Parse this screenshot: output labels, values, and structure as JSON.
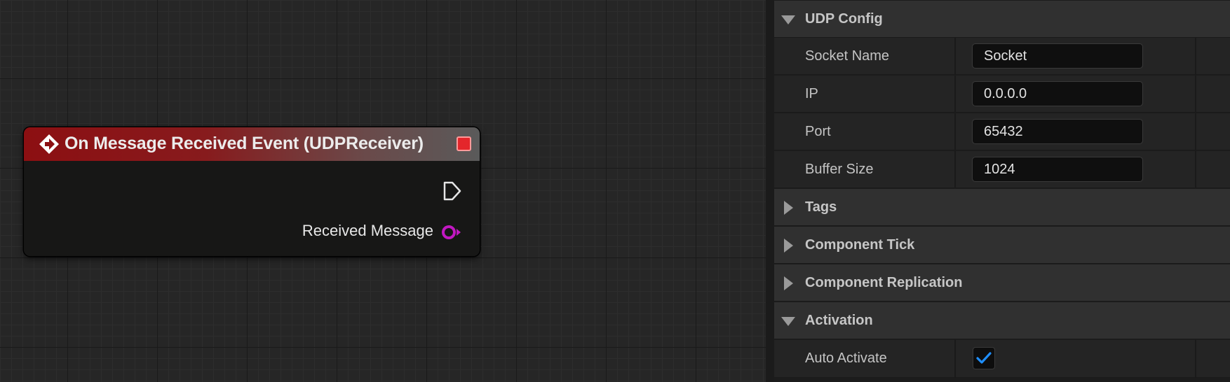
{
  "graph": {
    "node": {
      "title": "On Message Received Event (UDPReceiver)",
      "output_pin_label": "Received Message",
      "header_color": "#8c0f12",
      "close_color": "#e4262b",
      "data_pin_color": "#c218c2"
    }
  },
  "details": {
    "udp_config": {
      "label": "UDP Config",
      "expanded": true,
      "properties": {
        "socket_name": {
          "label": "Socket Name",
          "value": "Socket"
        },
        "ip": {
          "label": "IP",
          "value": "0.0.0.0"
        },
        "port": {
          "label": "Port",
          "value": "65432"
        },
        "buffer_size": {
          "label": "Buffer Size",
          "value": "1024"
        }
      }
    },
    "tags": {
      "label": "Tags",
      "expanded": false
    },
    "component_tick": {
      "label": "Component Tick",
      "expanded": false
    },
    "component_replication": {
      "label": "Component Replication",
      "expanded": false
    },
    "activation": {
      "label": "Activation",
      "expanded": true,
      "auto_activate": {
        "label": "Auto Activate",
        "checked": true
      }
    }
  },
  "colors": {
    "checkmark": "#1f8fff",
    "panel_category_bg": "#303030",
    "panel_property_bg": "#242424"
  }
}
